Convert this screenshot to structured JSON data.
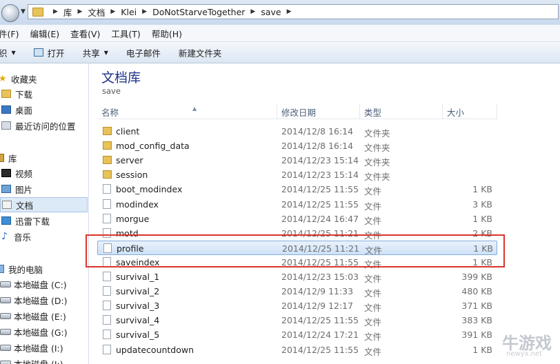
{
  "address": {
    "crumbs": [
      "库",
      "文档",
      "Klei",
      "DoNotStarveTogether",
      "save"
    ]
  },
  "menu": [
    "件(F)",
    "编辑(E)",
    "查看(V)",
    "工具(T)",
    "帮助(H)"
  ],
  "toolbar": {
    "organize": "织",
    "open": "打开",
    "share": "共享",
    "email": "电子邮件",
    "new_folder": "新建文件夹"
  },
  "nav": {
    "favorites": "收藏夹",
    "downloads": "下载",
    "desktop": "桌面",
    "recent": "最近访问的位置",
    "libraries": "库",
    "video": "视频",
    "pictures": "图片",
    "documents": "文档",
    "xunlei": "迅雷下载",
    "music": "音乐",
    "computer": "我的电脑",
    "drive_c": "本地磁盘 (C:)",
    "drive_d": "本地磁盘 (D:)",
    "drive_e": "本地磁盘 (E:)",
    "drive_g": "本地磁盘 (G:)",
    "drive_i": "本地磁盘 (I:)",
    "drive_j": "本地磁盘 (J:)"
  },
  "library": {
    "title": "文档库",
    "subtitle": "save"
  },
  "columns": {
    "name": "名称",
    "date": "修改日期",
    "type": "类型",
    "size": "大小"
  },
  "files": [
    {
      "name": "client",
      "date": "2014/12/8 16:14",
      "type": "文件夹",
      "size": "",
      "kind": "folder"
    },
    {
      "name": "mod_config_data",
      "date": "2014/12/8 16:14",
      "type": "文件夹",
      "size": "",
      "kind": "folder"
    },
    {
      "name": "server",
      "date": "2014/12/23 15:14",
      "type": "文件夹",
      "size": "",
      "kind": "folder"
    },
    {
      "name": "session",
      "date": "2014/12/23 15:14",
      "type": "文件夹",
      "size": "",
      "kind": "folder"
    },
    {
      "name": "boot_modindex",
      "date": "2014/12/25 11:55",
      "type": "文件",
      "size": "1 KB",
      "kind": "file"
    },
    {
      "name": "modindex",
      "date": "2014/12/25 11:55",
      "type": "文件",
      "size": "3 KB",
      "kind": "file"
    },
    {
      "name": "morgue",
      "date": "2014/12/24 16:47",
      "type": "文件",
      "size": "1 KB",
      "kind": "file"
    },
    {
      "name": "motd",
      "date": "2014/12/25 11:21",
      "type": "文件",
      "size": "2 KB",
      "kind": "file"
    },
    {
      "name": "profile",
      "date": "2014/12/25 11:21",
      "type": "文件",
      "size": "1 KB",
      "kind": "file"
    },
    {
      "name": "saveindex",
      "date": "2014/12/25 11:55",
      "type": "文件",
      "size": "1 KB",
      "kind": "file"
    },
    {
      "name": "survival_1",
      "date": "2014/12/23 15:03",
      "type": "文件",
      "size": "399 KB",
      "kind": "file"
    },
    {
      "name": "survival_2",
      "date": "2014/12/9 11:33",
      "type": "文件",
      "size": "480 KB",
      "kind": "file"
    },
    {
      "name": "survival_3",
      "date": "2014/12/9 12:17",
      "type": "文件",
      "size": "371 KB",
      "kind": "file"
    },
    {
      "name": "survival_4",
      "date": "2014/12/25 11:55",
      "type": "文件",
      "size": "383 KB",
      "kind": "file"
    },
    {
      "name": "survival_5",
      "date": "2014/12/24 17:21",
      "type": "文件",
      "size": "391 KB",
      "kind": "file"
    },
    {
      "name": "updatecountdown",
      "date": "2014/12/25 11:55",
      "type": "文件",
      "size": "1 KB",
      "kind": "file"
    }
  ],
  "selected_file": "profile",
  "watermark": {
    "text": "牛游戏",
    "sub": "newyx.net"
  },
  "colors": {
    "highlight_box": "#d9342b",
    "library_title": "#1e3287"
  }
}
